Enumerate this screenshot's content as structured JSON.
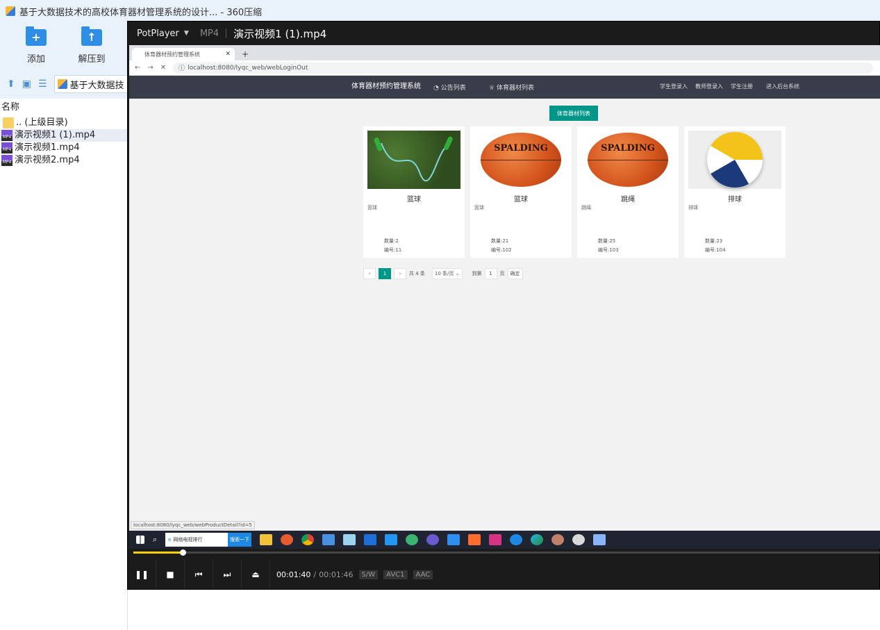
{
  "archive": {
    "title": "基于大数据技术的高校体育器材管理系统的设计... - 360压缩",
    "toolbar": {
      "add_label": "添加",
      "extract_label": "解压到"
    },
    "path": "基于大数据技",
    "column_name": "名称",
    "files": [
      {
        "name": ".. (上级目录)",
        "type": "dir"
      },
      {
        "name": "演示视频1 (1).mp4",
        "type": "mp4"
      },
      {
        "name": "演示视频1.mp4",
        "type": "mp4"
      },
      {
        "name": "演示视频2.mp4",
        "type": "mp4"
      }
    ]
  },
  "player": {
    "brand": "PotPlayer",
    "format": "MP4",
    "file_title": "演示视频1 (1).mp4",
    "current_time": "00:01:40",
    "total_time": "00:01:46",
    "progress": 0.066,
    "badges": [
      "S/W",
      "AVC1",
      "AAC"
    ]
  },
  "browser": {
    "tab_title": "体育器材预约管理系统",
    "url": "localhost:8080/lyqc_web/webLoginOut",
    "status_url": "localhost:8080/lyqc_web/webProductDetail?id=5"
  },
  "site": {
    "logo": "体育器材预约管理系统",
    "nav": [
      "公告列表",
      "体育器材列表"
    ],
    "right_nav": [
      "学生登录入",
      "教师登录入",
      "学生注册",
      "进入后台系统"
    ],
    "category_button": "体育器材列表",
    "products": [
      {
        "name": "篮球",
        "desc": "篮球",
        "qty": "数量:2",
        "id": "编号:11",
        "image": "jump-rope"
      },
      {
        "name": "篮球",
        "desc": "篮球",
        "qty": "数量:21",
        "id": "编号:102",
        "image": "basketball",
        "brand": "SPALDING"
      },
      {
        "name": "跳绳",
        "desc": "跳绳",
        "qty": "数量:25",
        "id": "编号:103",
        "image": "basketball",
        "brand": "SPALDING"
      },
      {
        "name": "排球",
        "desc": "排球",
        "qty": "数量:23",
        "id": "编号:104",
        "image": "volleyball"
      }
    ],
    "pager": {
      "prev": "‹",
      "current": "1",
      "next": "›",
      "total": "共 4 条",
      "per_page": "10 条/页",
      "goto": "到第",
      "goto_page": "1",
      "page_unit": "页",
      "confirm": "确定"
    }
  },
  "taskbar": {
    "search_text": "网络电视排行",
    "search_button": "搜索一下"
  }
}
